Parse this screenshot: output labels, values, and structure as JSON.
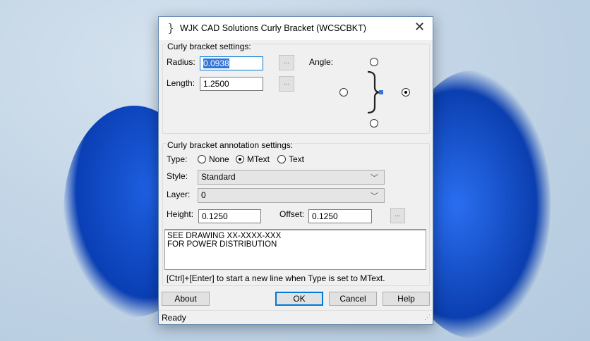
{
  "window": {
    "title": "WJK CAD Solutions Curly Bracket (WCSCBKT)",
    "close": "✕"
  },
  "bracket_settings": {
    "label": "Curly bracket settings:",
    "radius_label": "Radius:",
    "radius_value": "0.0938",
    "length_label": "Length:",
    "length_value": "1.2500",
    "browse": "...",
    "angle_label": "Angle:",
    "angle_selected": "right"
  },
  "annotation": {
    "label": "Curly bracket annotation settings:",
    "type_label": "Type:",
    "types": [
      "None",
      "MText",
      "Text"
    ],
    "type_selected": "MText",
    "style_label": "Style:",
    "style_value": "Standard",
    "layer_label": "Layer:",
    "layer_value": "0",
    "height_label": "Height:",
    "height_value": "0.1250",
    "offset_label": "Offset:",
    "offset_value": "0.1250",
    "browse": "...",
    "text_lines": [
      "SEE DRAWING XX-XXXX-XXX",
      "FOR POWER DISTRIBUTION"
    ],
    "hint": "[Ctrl]+[Enter] to start a new line when Type is set to MText."
  },
  "buttons": {
    "about": "About",
    "ok": "OK",
    "cancel": "Cancel",
    "help": "Help"
  },
  "status": "Ready",
  "colors": {
    "accent": "#0078d7",
    "selection": "#3375d6"
  }
}
